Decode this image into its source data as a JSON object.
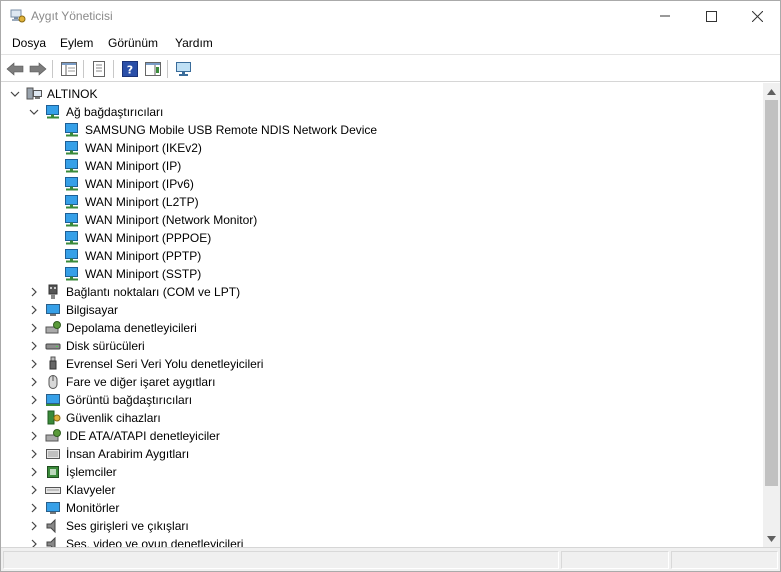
{
  "window": {
    "title": "Aygıt Yöneticisi"
  },
  "menu": {
    "dosya": "Dosya",
    "eylem": "Eylem",
    "gorunum": "Görünüm",
    "yardim": "Yardım"
  },
  "tree": {
    "root": "ALTINOK",
    "network": {
      "label": "Ağ bağdaştırıcıları",
      "children": [
        "SAMSUNG Mobile USB Remote NDIS Network Device",
        "WAN Miniport (IKEv2)",
        "WAN Miniport (IP)",
        "WAN Miniport (IPv6)",
        "WAN Miniport (L2TP)",
        "WAN Miniport (Network Monitor)",
        "WAN Miniport (PPPOE)",
        "WAN Miniport (PPTP)",
        "WAN Miniport (SSTP)"
      ]
    },
    "categories": [
      "Bağlantı noktaları (COM ve LPT)",
      "Bilgisayar",
      "Depolama denetleyicileri",
      "Disk sürücüleri",
      "Evrensel Seri Veri Yolu denetleyicileri",
      "Fare ve diğer işaret aygıtları",
      "Görüntü bağdaştırıcıları",
      "Güvenlik cihazları",
      "IDE ATA/ATAPI denetleyiciler",
      "İnsan Arabirim Aygıtları",
      "İşlemciler",
      "Klavyeler",
      "Monitörler",
      "Ses girişleri ve çıkışları",
      "Ses, video ve oyun denetleyicileri"
    ]
  },
  "colors": {
    "title_text": "#8a8a8a",
    "network_icon": "#2e8fd6",
    "scrollbar_thumb": "#c1c1c1"
  }
}
